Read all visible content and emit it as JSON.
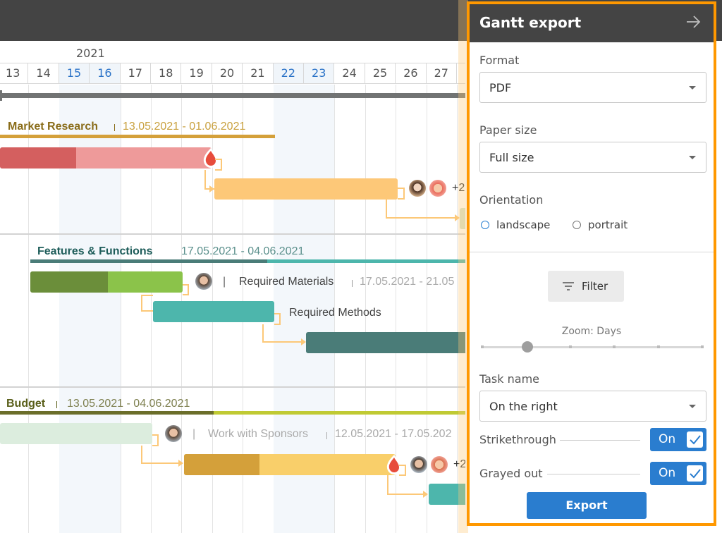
{
  "timeline": {
    "year": "2021",
    "days": [
      {
        "label": "13",
        "weekend": false
      },
      {
        "label": "14",
        "weekend": false
      },
      {
        "label": "15",
        "weekend": true
      },
      {
        "label": "16",
        "weekend": true
      },
      {
        "label": "17",
        "weekend": false
      },
      {
        "label": "18",
        "weekend": false
      },
      {
        "label": "19",
        "weekend": false
      },
      {
        "label": "20",
        "weekend": false
      },
      {
        "label": "21",
        "weekend": false
      },
      {
        "label": "22",
        "weekend": true
      },
      {
        "label": "23",
        "weekend": true
      },
      {
        "label": "24",
        "weekend": false
      },
      {
        "label": "25",
        "weekend": false
      },
      {
        "label": "26",
        "weekend": false
      },
      {
        "label": "27",
        "weekend": false
      }
    ]
  },
  "groups": [
    {
      "title": "Market Research",
      "dates": "13.05.2021 - 01.06.2021",
      "color": "#8a6d1a",
      "line_color": "#d4a03a"
    },
    {
      "title": "Features & Functions",
      "dates": "17.05.2021 - 04.06.2021",
      "color": "#1e5d5a",
      "line_color": "#4a7c78",
      "line_color_2": "#4db6ac"
    },
    {
      "title": "Budget",
      "dates": "13.05.2021 - 04.06.2021",
      "color": "#5a5f1a",
      "line_color": "#6b6e2a",
      "line_color_2": "#c0ca33"
    }
  ],
  "tasks": {
    "required_materials": {
      "separator": "|",
      "name": "Required Materials",
      "dates": "17.05.2021 - 21.05"
    },
    "required_methods": {
      "name": "Required Methods"
    },
    "work_with_sponsors": {
      "separator": "|",
      "name": "Work with Sponsors",
      "dates": "12.05.2021 - 17.05.202"
    },
    "extra_assignees_1": "+2",
    "extra_assignees_2": "+2"
  },
  "colors": {
    "accent_blue": "#2a7dcf",
    "panel_border": "#ff9800",
    "critical_red": "#e74c3c"
  },
  "export_panel": {
    "title": "Gantt export",
    "format_label": "Format",
    "format_value": "PDF",
    "paper_size_label": "Paper size",
    "paper_size_value": "Full size",
    "orientation_label": "Orientation",
    "orientation_options": [
      "landscape",
      "portrait"
    ],
    "orientation_selected": "landscape",
    "filter_label": "Filter",
    "zoom_label": "Zoom: Days",
    "zoom_level_index": 1,
    "zoom_levels_count": 6,
    "task_name_label": "Task name",
    "task_name_value": "On the right",
    "strikethrough_label": "Strikethrough",
    "strikethrough_state": "On",
    "grayed_out_label": "Grayed out",
    "grayed_out_state": "On",
    "export_label": "Export"
  }
}
